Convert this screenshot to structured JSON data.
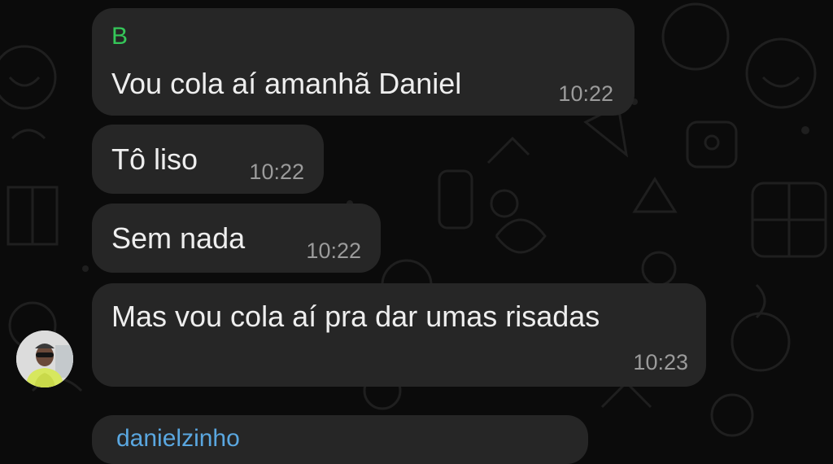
{
  "chat": {
    "messages": [
      {
        "sender": "B",
        "text": "Vou cola aí amanhã Daniel",
        "time": "10:22"
      },
      {
        "text": "Tô liso",
        "time": "10:22"
      },
      {
        "text": "Sem nada",
        "time": "10:22"
      },
      {
        "text": "Mas vou cola aí pra dar umas risadas",
        "time": "10:23"
      }
    ],
    "next_message": {
      "sender_partial": "danielzinho"
    }
  },
  "colors": {
    "background": "#0b0b0b",
    "bubble": "#262626",
    "sender_name": "#35c759",
    "reply_name": "#5aa7e0",
    "time": "#9b9b9b"
  },
  "icons": [
    "doodle-wallpaper",
    "avatar-photo"
  ]
}
